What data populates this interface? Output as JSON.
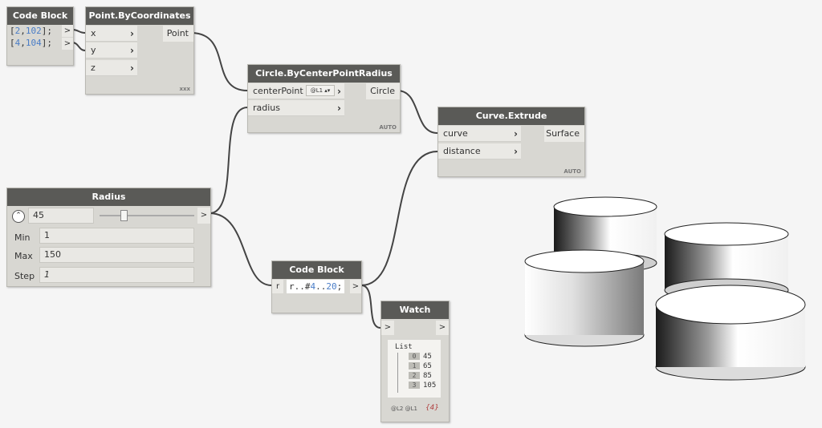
{
  "colors": {
    "canvas": "#f5f5f5",
    "node_bg": "#d8d7d2",
    "title_bg": "#5a5a57",
    "wire": "#444444",
    "number": "#4a7dc7"
  },
  "code_block_1": {
    "title": "Code Block",
    "lines": [
      {
        "pre": "[",
        "a": "2",
        "sep": ",",
        "b": "102",
        "post": "];"
      },
      {
        "pre": "[",
        "a": "4",
        "sep": ",",
        "b": "104",
        "post": "];"
      }
    ],
    "out1": ">",
    "out2": ">"
  },
  "point_node": {
    "title": "Point.ByCoordinates",
    "inputs": [
      "x",
      "y",
      "z"
    ],
    "output": "Point",
    "lacing": "xxx"
  },
  "circle_node": {
    "title": "Circle.ByCenterPointRadius",
    "inputs": [
      "centerPoint",
      "radius"
    ],
    "level": "@L1",
    "output": "Circle",
    "lacing": "AUTO"
  },
  "extrude_node": {
    "title": "Curve.Extrude",
    "inputs": [
      "curve",
      "distance"
    ],
    "output": "Surface",
    "lacing": "AUTO"
  },
  "radius_slider": {
    "title": "Radius",
    "value": "45",
    "out": ">",
    "expand_icon": "chevron-up-icon",
    "level": 0.24,
    "min_label": "Min",
    "min": "1",
    "max_label": "Max",
    "max": "150",
    "step_label": "Step",
    "step": "1"
  },
  "code_block_2": {
    "title": "Code Block",
    "input": "r",
    "code_a": "r..#",
    "code_n1": "4",
    "code_b": "..",
    "code_n2": "20",
    "code_c": ";",
    "out": ">"
  },
  "watch_node": {
    "title": "Watch",
    "in": ">",
    "out": ">",
    "list_label": "List",
    "items": [
      {
        "index": "0",
        "value": "45"
      },
      {
        "index": "1",
        "value": "65"
      },
      {
        "index": "2",
        "value": "85"
      },
      {
        "index": "3",
        "value": "105"
      }
    ],
    "levels": "@L2 @L1",
    "count": "{4}"
  }
}
